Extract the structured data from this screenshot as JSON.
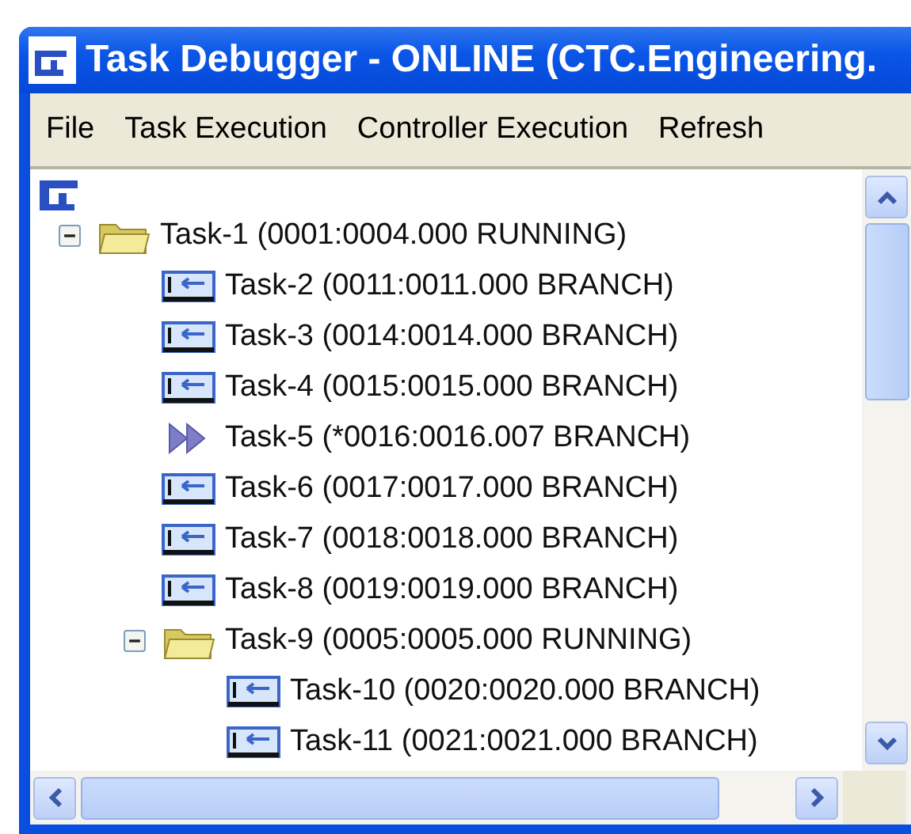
{
  "window": {
    "title": "Task Debugger - ONLINE (CTC.Engineering."
  },
  "menu": [
    "File",
    "Task Execution",
    "Controller Execution",
    "Refresh"
  ],
  "tree": [
    {
      "label": "Task-1 (0001:0004.000 RUNNING)",
      "kind": "folder",
      "expanded": true,
      "children": [
        {
          "label": "Task-2 (0011:0011.000 BRANCH)",
          "kind": "task"
        },
        {
          "label": "Task-3 (0014:0014.000 BRANCH)",
          "kind": "task"
        },
        {
          "label": "Task-4 (0015:0015.000 BRANCH)",
          "kind": "task"
        },
        {
          "label": "Task-5 (*0016:0016.007 BRANCH)",
          "kind": "current"
        },
        {
          "label": "Task-6 (0017:0017.000 BRANCH)",
          "kind": "task"
        },
        {
          "label": "Task-7 (0018:0018.000 BRANCH)",
          "kind": "task"
        },
        {
          "label": "Task-8 (0019:0019.000 BRANCH)",
          "kind": "task"
        },
        {
          "label": "Task-9 (0005:0005.000 RUNNING)",
          "kind": "folder",
          "expanded": true,
          "children": [
            {
              "label": "Task-10 (0020:0020.000 BRANCH)",
              "kind": "task"
            },
            {
              "label": "Task-11 (0021:0021.000 BRANCH)",
              "kind": "task"
            }
          ]
        }
      ]
    }
  ]
}
